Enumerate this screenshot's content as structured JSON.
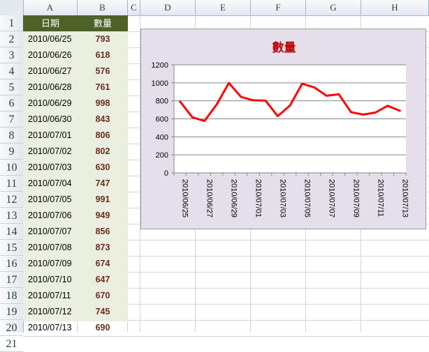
{
  "columns": [
    "A",
    "B",
    "C",
    "D",
    "E",
    "F",
    "G",
    "H"
  ],
  "rows": [
    "1",
    "2",
    "3",
    "4",
    "5",
    "6",
    "7",
    "8",
    "9",
    "10",
    "11",
    "12",
    "13",
    "14",
    "15",
    "16",
    "17",
    "18",
    "19",
    "20",
    "21"
  ],
  "table": {
    "header_date": "日期",
    "header_qty": "數量",
    "records": [
      {
        "date": "2010/06/25",
        "qty": "793"
      },
      {
        "date": "2010/06/26",
        "qty": "618"
      },
      {
        "date": "2010/06/27",
        "qty": "576"
      },
      {
        "date": "2010/06/28",
        "qty": "761"
      },
      {
        "date": "2010/06/29",
        "qty": "998"
      },
      {
        "date": "2010/06/30",
        "qty": "843"
      },
      {
        "date": "2010/07/01",
        "qty": "806"
      },
      {
        "date": "2010/07/02",
        "qty": "802"
      },
      {
        "date": "2010/07/03",
        "qty": "630"
      },
      {
        "date": "2010/07/04",
        "qty": "747"
      },
      {
        "date": "2010/07/05",
        "qty": "991"
      },
      {
        "date": "2010/07/06",
        "qty": "949"
      },
      {
        "date": "2010/07/07",
        "qty": "856"
      },
      {
        "date": "2010/07/08",
        "qty": "873"
      },
      {
        "date": "2010/07/09",
        "qty": "674"
      },
      {
        "date": "2010/07/10",
        "qty": "647"
      },
      {
        "date": "2010/07/11",
        "qty": "670"
      },
      {
        "date": "2010/07/12",
        "qty": "745"
      },
      {
        "date": "2010/07/13",
        "qty": "690"
      }
    ]
  },
  "colors": {
    "header_fill": "#4e6228",
    "data_fill": "#eaefe0",
    "value_text": "#6b2b1f",
    "chart_bg": "#e5dfec",
    "line": "#ff0000",
    "title": "#c00000"
  },
  "chart_data": {
    "type": "line",
    "title": "數量",
    "x": [
      "2010/06/25",
      "2010/06/26",
      "2010/06/27",
      "2010/06/28",
      "2010/06/29",
      "2010/06/30",
      "2010/07/01",
      "2010/07/02",
      "2010/07/03",
      "2010/07/04",
      "2010/07/05",
      "2010/07/06",
      "2010/07/07",
      "2010/07/08",
      "2010/07/09",
      "2010/07/10",
      "2010/07/11",
      "2010/07/12",
      "2010/07/13"
    ],
    "x_tick_labels": [
      "2010/06/25",
      "2010/06/27",
      "2010/06/29",
      "2010/07/01",
      "2010/07/03",
      "2010/07/05",
      "2010/07/07",
      "2010/07/09",
      "2010/07/11",
      "2010/07/13"
    ],
    "series": [
      {
        "values": [
          793,
          618,
          576,
          761,
          998,
          843,
          806,
          802,
          630,
          747,
          991,
          949,
          856,
          873,
          674,
          647,
          670,
          745,
          690
        ]
      }
    ],
    "ylim": [
      0,
      1200
    ],
    "yticks": [
      "0",
      "200",
      "400",
      "600",
      "800",
      "1000",
      "1200"
    ],
    "grid": true,
    "legend": "none"
  }
}
